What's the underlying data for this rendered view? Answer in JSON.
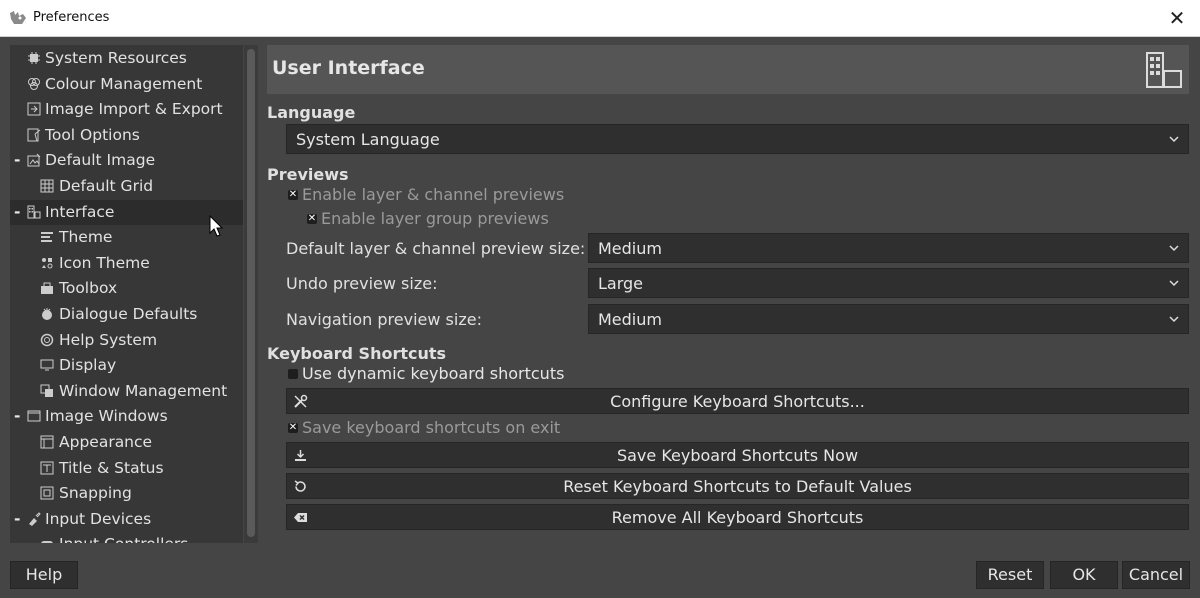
{
  "window": {
    "title": "Preferences",
    "close_glyph": "✕"
  },
  "sidebar": {
    "items": [
      {
        "label": "System Resources",
        "icon": "chip-icon",
        "level": 0,
        "expander": ""
      },
      {
        "label": "Colour Management",
        "icon": "color-circles-icon",
        "level": 0,
        "expander": ""
      },
      {
        "label": "Image Import & Export",
        "icon": "import-export-icon",
        "level": 0,
        "expander": ""
      },
      {
        "label": "Tool Options",
        "icon": "tool-options-icon",
        "level": 0,
        "expander": ""
      },
      {
        "label": "Default Image",
        "icon": "default-image-icon",
        "level": 0,
        "expander": "-"
      },
      {
        "label": "Default Grid",
        "icon": "grid-icon",
        "level": 1,
        "expander": ""
      },
      {
        "label": "Interface",
        "icon": "interface-icon",
        "level": 0,
        "expander": "-",
        "selected": true
      },
      {
        "label": "Theme",
        "icon": "theme-icon",
        "level": 1,
        "expander": ""
      },
      {
        "label": "Icon Theme",
        "icon": "icon-theme-icon",
        "level": 1,
        "expander": ""
      },
      {
        "label": "Toolbox",
        "icon": "toolbox-icon",
        "level": 1,
        "expander": ""
      },
      {
        "label": "Dialogue Defaults",
        "icon": "dialogue-defaults-icon",
        "level": 1,
        "expander": ""
      },
      {
        "label": "Help System",
        "icon": "help-system-icon",
        "level": 1,
        "expander": ""
      },
      {
        "label": "Display",
        "icon": "display-icon",
        "level": 1,
        "expander": ""
      },
      {
        "label": "Window Management",
        "icon": "window-management-icon",
        "level": 1,
        "expander": ""
      },
      {
        "label": "Image Windows",
        "icon": "image-windows-icon",
        "level": 0,
        "expander": "-"
      },
      {
        "label": "Appearance",
        "icon": "appearance-icon",
        "level": 1,
        "expander": ""
      },
      {
        "label": "Title & Status",
        "icon": "title-status-icon",
        "level": 1,
        "expander": ""
      },
      {
        "label": "Snapping",
        "icon": "snapping-icon",
        "level": 1,
        "expander": ""
      },
      {
        "label": "Input Devices",
        "icon": "input-devices-icon",
        "level": 0,
        "expander": "-"
      },
      {
        "label": "Input Controllers",
        "icon": "input-controllers-icon",
        "level": 1,
        "expander": ""
      }
    ]
  },
  "main": {
    "title": "User Interface",
    "language": {
      "heading": "Language",
      "value": "System Language"
    },
    "previews": {
      "heading": "Previews",
      "enable_layer_previews": {
        "label": "Enable layer & channel previews",
        "checked": true
      },
      "enable_group_previews": {
        "label": "Enable layer group previews",
        "checked": true
      },
      "default_size_label": "Default layer & channel preview size:",
      "default_size_value": "Medium",
      "undo_size_label": "Undo preview size:",
      "undo_size_value": "Large",
      "nav_size_label": "Navigation preview size:",
      "nav_size_value": "Medium"
    },
    "shortcuts": {
      "heading": "Keyboard Shortcuts",
      "dynamic": {
        "label": "Use dynamic keyboard shortcuts",
        "checked": false
      },
      "configure_label": "Configure Keyboard Shortcuts...",
      "save_on_exit": {
        "label": "Save keyboard shortcuts on exit",
        "checked": true
      },
      "save_now_label": "Save Keyboard Shortcuts Now",
      "reset_label": "Reset Keyboard Shortcuts to Default Values",
      "remove_label": "Remove All Keyboard Shortcuts"
    }
  },
  "buttons": {
    "help": "Help",
    "reset": "Reset",
    "ok": "OK",
    "cancel": "Cancel"
  }
}
